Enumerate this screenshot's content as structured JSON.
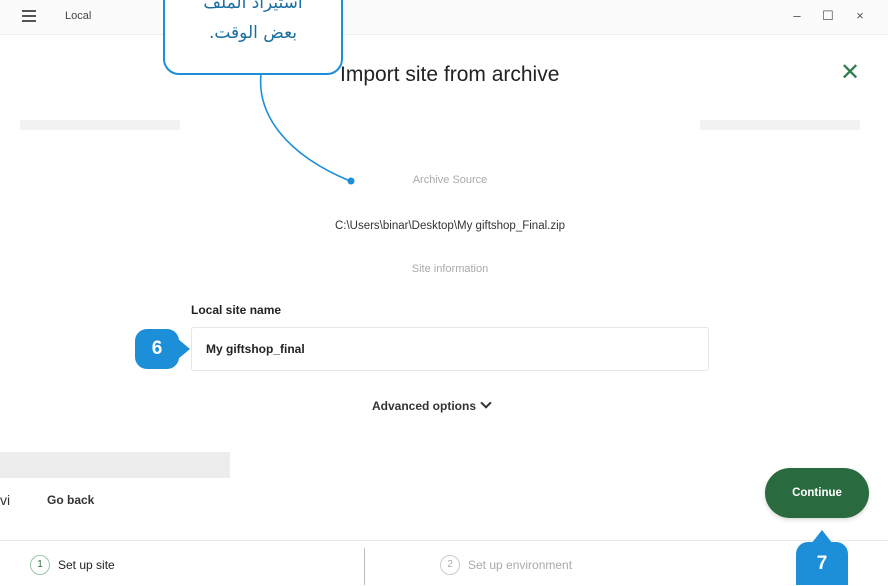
{
  "window": {
    "app_title": "Local",
    "minimize": "–",
    "maximize": "☐",
    "close": "×"
  },
  "modal": {
    "title": "Import site from archive",
    "archive_source_label": "Archive Source",
    "archive_path": "C:\\Users\\binar\\Desktop\\My giftshop_Final.zip",
    "site_information_label": "Site information",
    "local_site_name_label": "Local site name",
    "local_site_name_value": "My giftshop_final",
    "advanced_options": "Advanced options",
    "close_symbol": "✕",
    "go_back": "Go back",
    "continue": "Continue"
  },
  "steps": [
    {
      "number": "1",
      "label": "Set up site"
    },
    {
      "number": "2",
      "label": "Set up environment"
    }
  ],
  "side_letter": "vi",
  "callout": {
    "line1": "استيراد الملف",
    "line2": "بعض الوقت."
  },
  "markers": {
    "marker6": "6",
    "marker7": "7"
  },
  "colors": {
    "accent_green": "#2a6a3f",
    "callout_blue": "#1d8fd8"
  }
}
